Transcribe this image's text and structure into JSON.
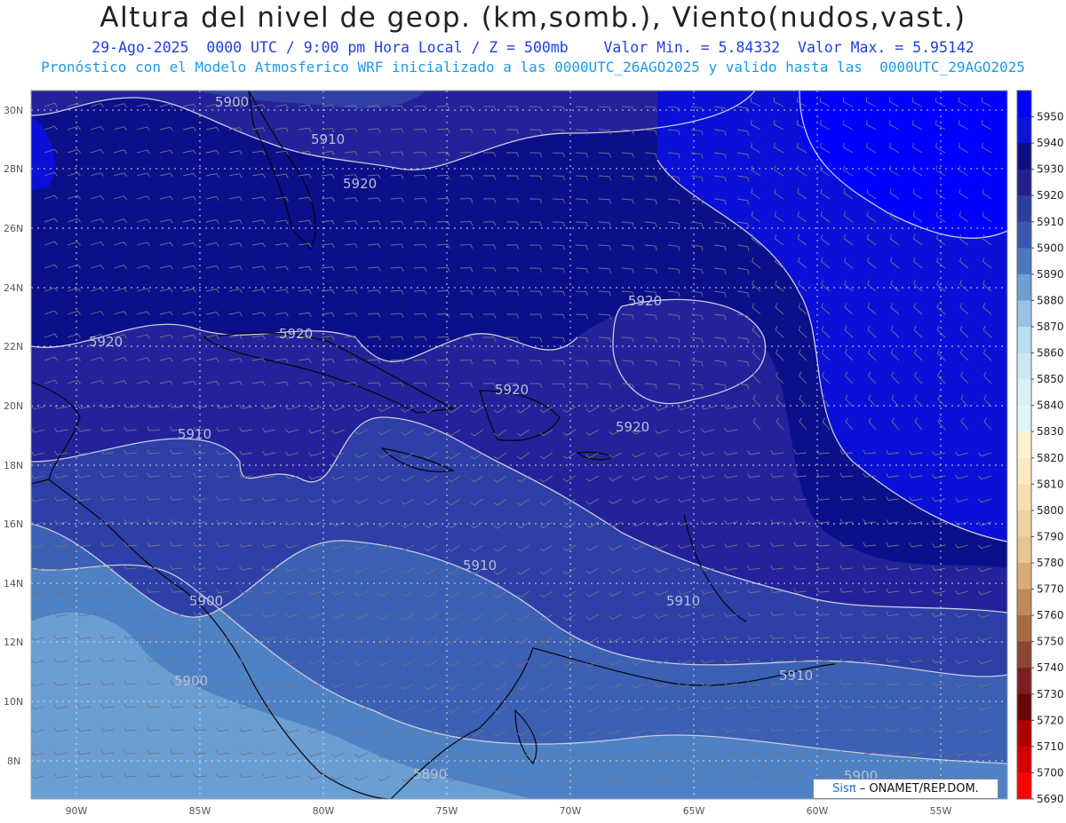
{
  "header": {
    "title": "Altura del nivel de geop. (km,somb.), Viento(nudos,vast.)",
    "subtitle": "29-Ago-2025  0000 UTC / 9:00 pm Hora Local / Z = 500mb    Valor Min. = 5.84332  Valor Max. = 5.95142",
    "subtitle2": "Pronóstico con el Modelo Atmosferico WRF inicializado a las 0000UTC_26AGO2025 y valido hasta las  0000UTC_29AGO2025"
  },
  "map": {
    "lat_labels": [
      "30N",
      "28N",
      "26N",
      "24N",
      "22N",
      "20N",
      "18N",
      "16N",
      "14N",
      "12N",
      "10N",
      "8N"
    ],
    "lon_labels": [
      "90W",
      "85W",
      "80W",
      "75W",
      "70W",
      "65W",
      "60W",
      "55W"
    ],
    "contour_labels": [
      "5900",
      "5910",
      "5920",
      "5920",
      "5920",
      "5920",
      "5920",
      "5920",
      "5910",
      "5910",
      "5910",
      "5900",
      "5900",
      "5910",
      "5890",
      "5900"
    ],
    "colors": {
      "c5950": "#0000ff",
      "c5940": "#0a10d8",
      "c5930": "#0c0f8a",
      "c5920": "#23229a",
      "c5910": "#2e3fa8",
      "c5900": "#3b60b4",
      "c5890": "#4f82c4",
      "c5880": "#6b9fd4"
    }
  },
  "colorbar": {
    "labels": [
      "5950",
      "5940",
      "5930",
      "5920",
      "5910",
      "5900",
      "5890",
      "5880",
      "5870",
      "5860",
      "5850",
      "5840",
      "5830",
      "5820",
      "5810",
      "5800",
      "5790",
      "5780",
      "5770",
      "5760",
      "5750",
      "5740",
      "5730",
      "5720",
      "5710",
      "5700",
      "5690"
    ],
    "colors": [
      "#0000ff",
      "#0b14d8",
      "#0c0e86",
      "#241f8e",
      "#2c3d9e",
      "#3a58ad",
      "#4b78be",
      "#6e9ed2",
      "#97c2e6",
      "#b9def0",
      "#cfe9f3",
      "#dbf0f6",
      "#e2f5f8",
      "#fdf3d0",
      "#fbeac0",
      "#f6e0b0",
      "#efd3a0",
      "#e7c591",
      "#d8ac77",
      "#c08a58",
      "#a86a40",
      "#8c4530",
      "#7a1e22",
      "#6a0508",
      "#b00000",
      "#d40000",
      "#ff0000"
    ]
  },
  "credit": {
    "brand": "Sisπ",
    "text": "– ONAMET/REP.DOM."
  }
}
